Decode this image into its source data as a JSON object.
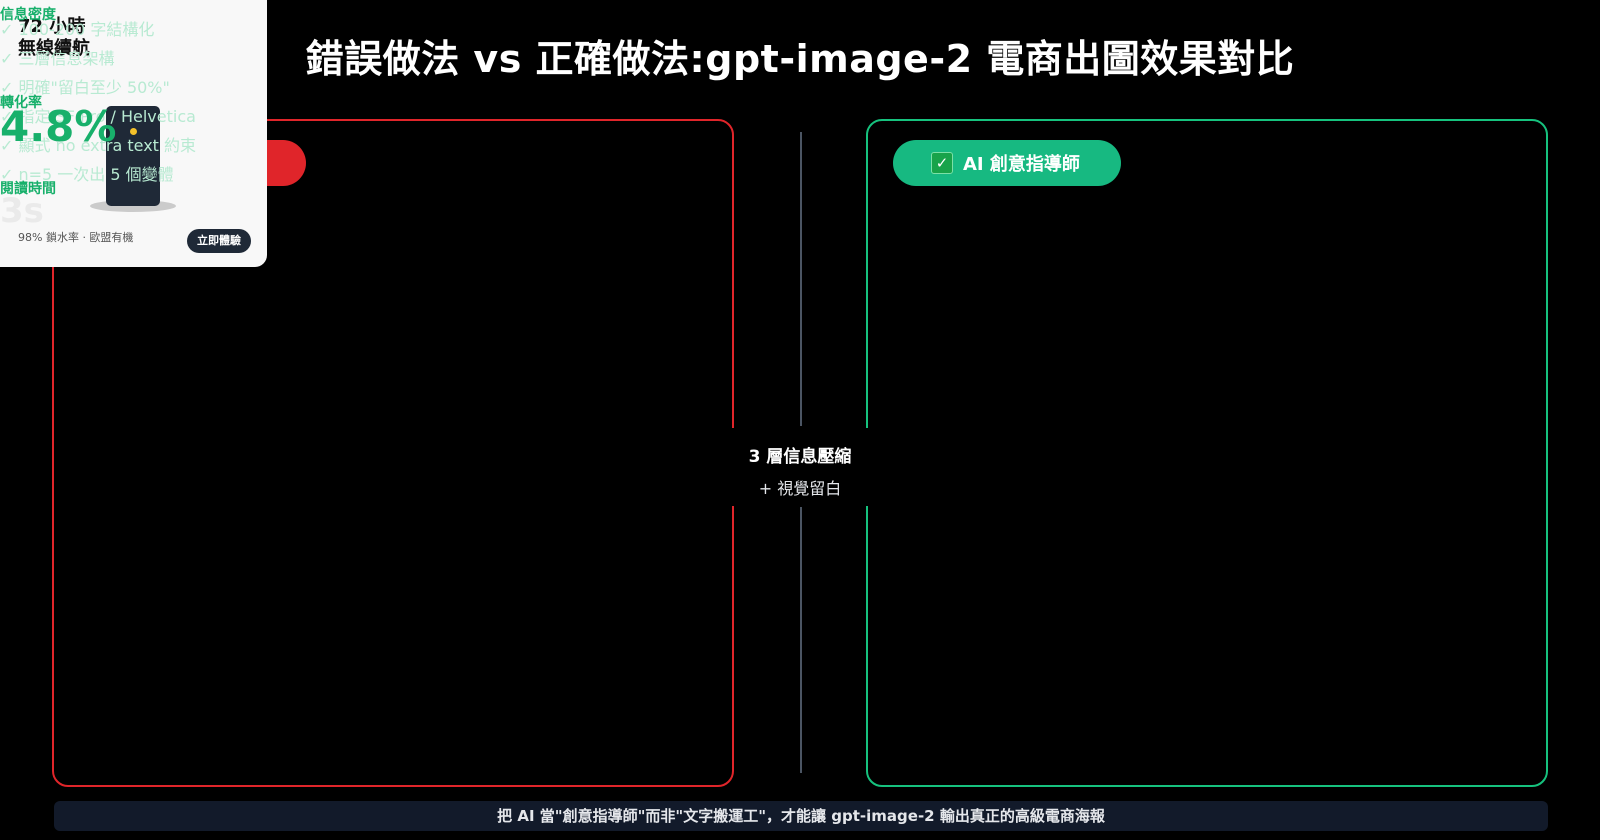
{
  "title": "錯誤做法 vs 正確做法:gpt-image-2 電商出圖效果對比",
  "left_panel": {
    "border_color": "#e0252a",
    "pill_label": ""
  },
  "right_panel": {
    "border_color": "#16c27e",
    "pill_icon": "check-mark-icon",
    "pill_label": "AI 創意指導師"
  },
  "divider": {
    "line1": "3 層信息壓縮",
    "line2": "+ 視覺留白"
  },
  "footer": "把 AI 當\"創意指導師\"而非\"文字搬運工\"，才能讓 gpt-image-2 輸出真正的高級電商海報",
  "card": {
    "headline_1": "72 小時",
    "headline_2": "無線續航",
    "checks": [
      "✓ 100-200 字結構化",
      "✓ 三層信息架構",
      "✓ 明確\"留白至少 50%\"",
      "✓ 指定 SF Pro / Helvetica",
      "✓ 顯式 no extra text 約束",
      "✓ n=5 一次出 5 個變體"
    ],
    "metric_label_0": "信息密度",
    "metric_1_label": "轉化率",
    "metric_1_value": "4.8%",
    "metric_2_label": "閱讀時間",
    "metric_2_value": "3s",
    "footnote": "98% 鎖水率 · 歐盟有機",
    "cta": "立即體驗"
  },
  "colors": {
    "accent_green": "#18b06b",
    "accent_red": "#e0252a",
    "footer_bg": "#121a2a"
  }
}
